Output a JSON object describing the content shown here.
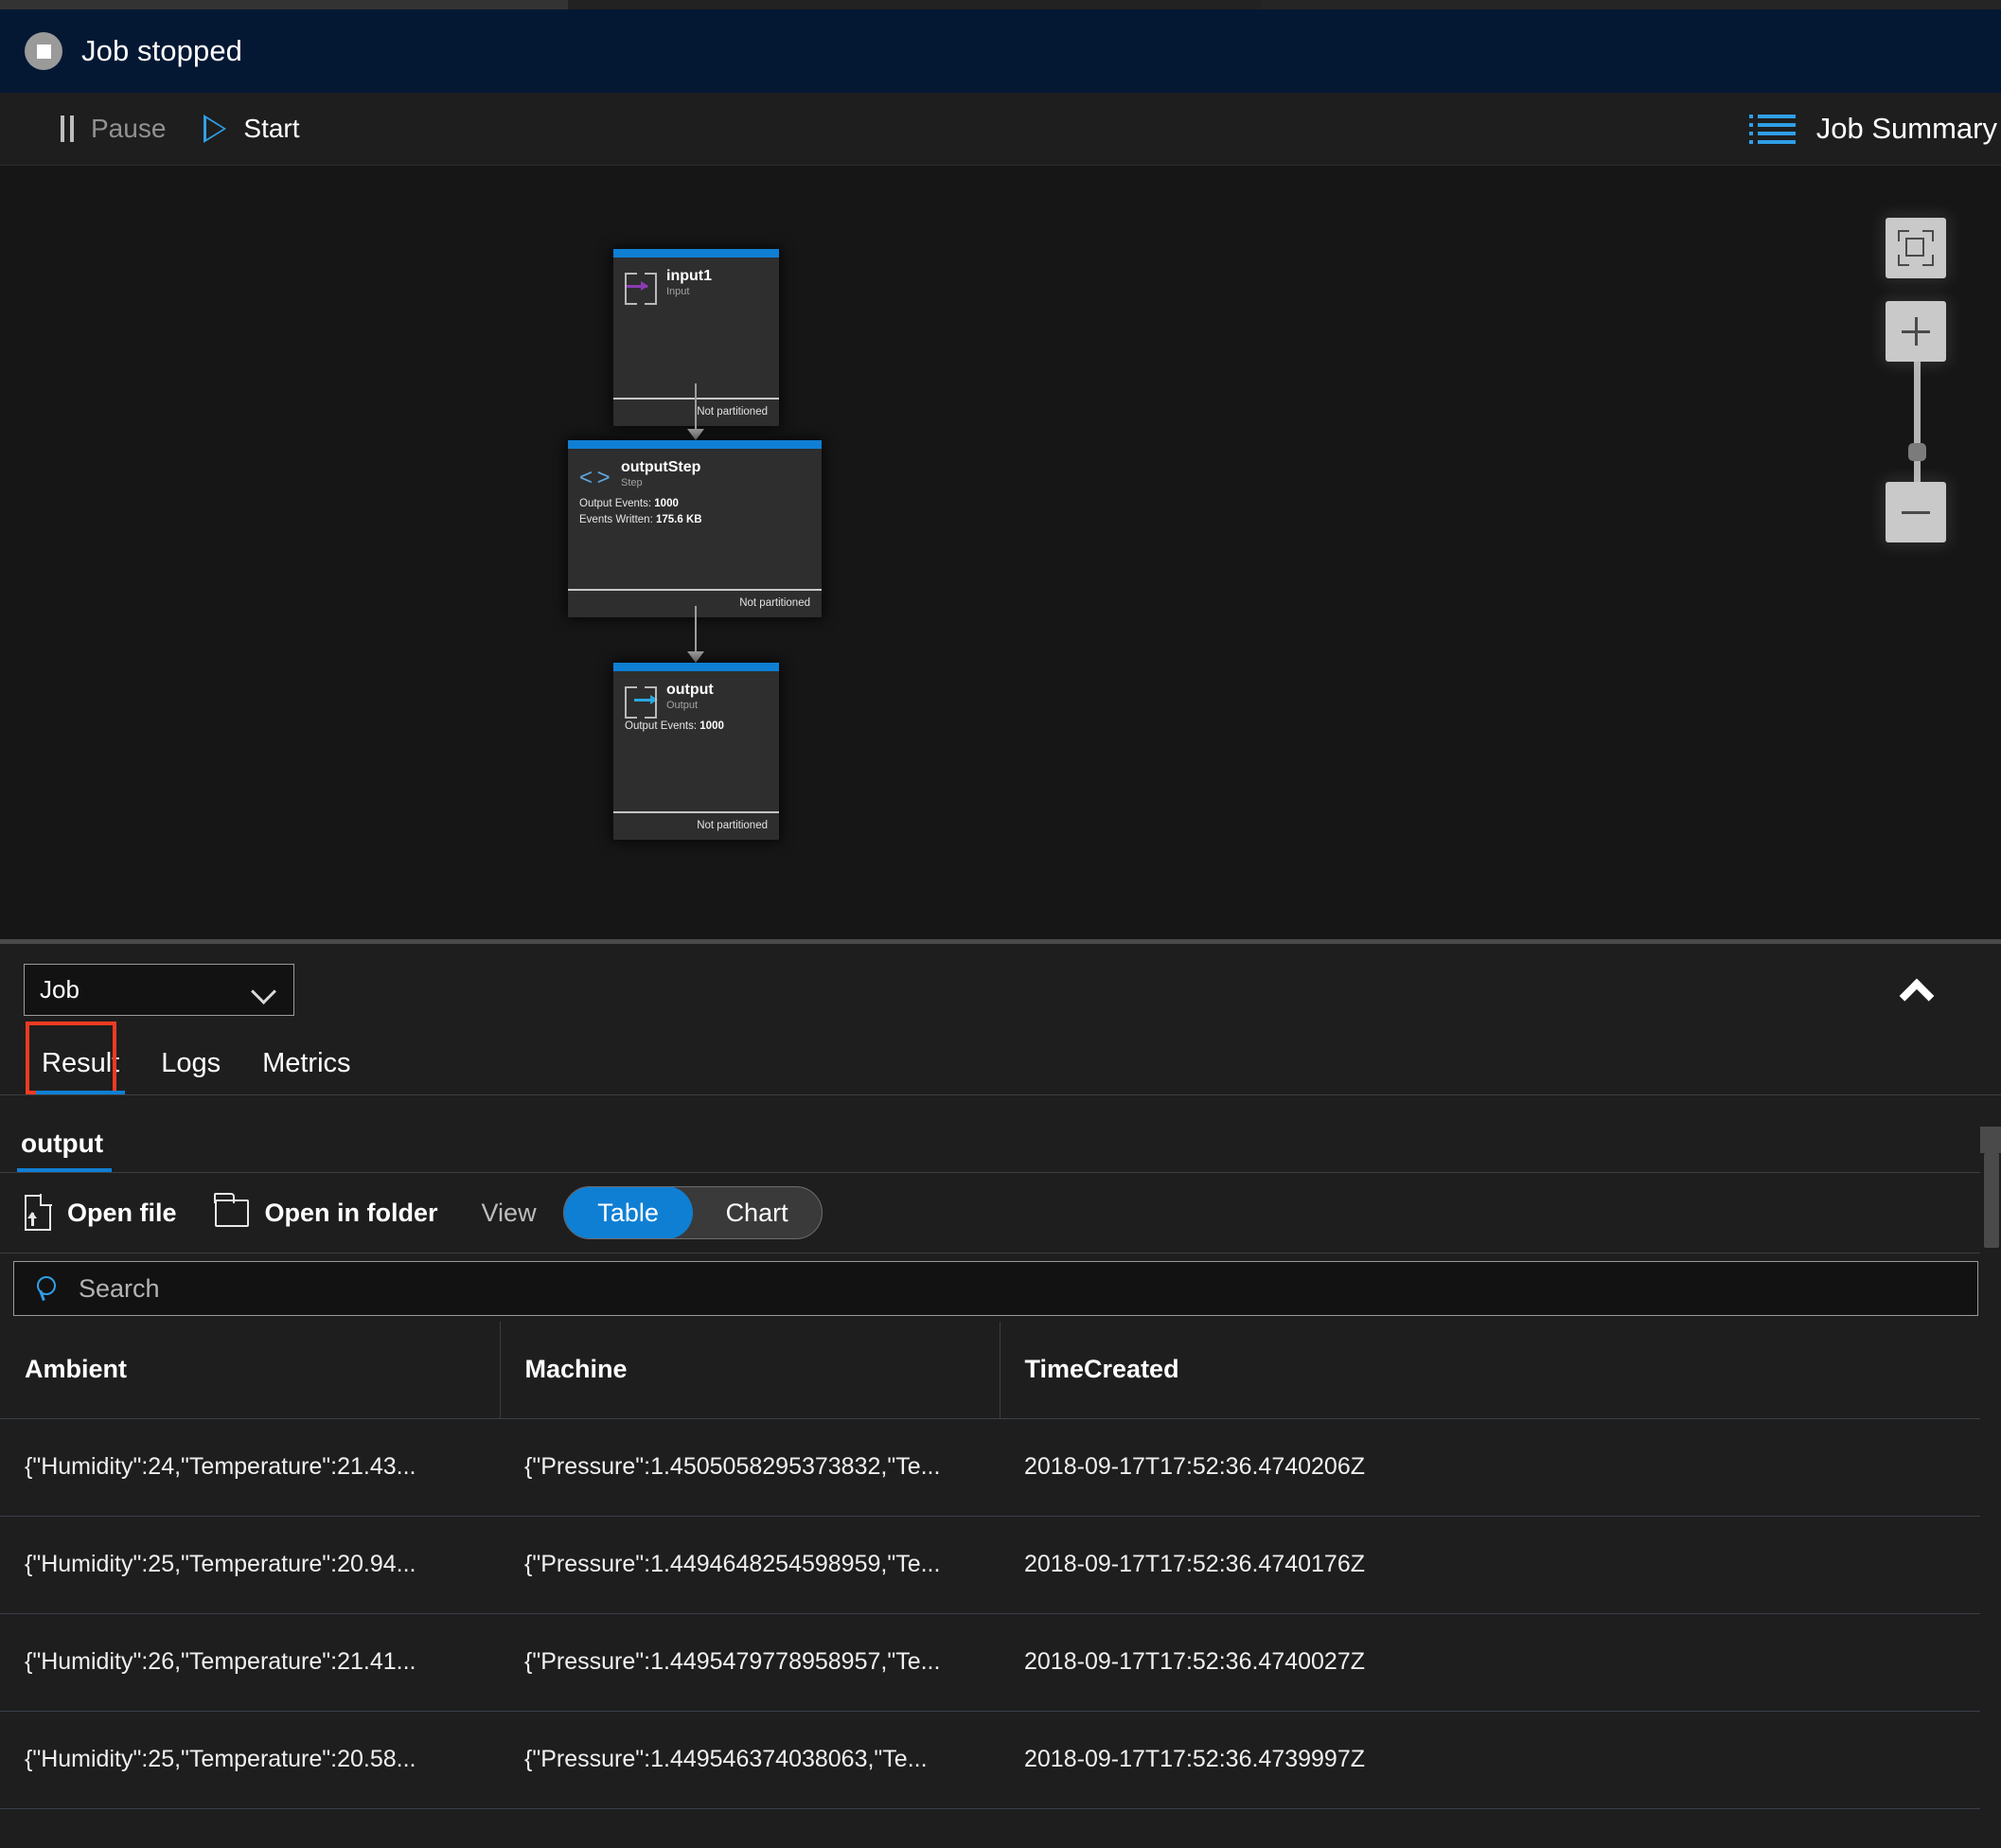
{
  "status": {
    "label": "Job stopped",
    "icon": "stop-circle-icon",
    "banner_color": "#041833"
  },
  "command_bar": {
    "pause": {
      "label": "Pause",
      "icon": "pause-icon",
      "enabled": false
    },
    "start": {
      "label": "Start",
      "icon": "play-icon",
      "enabled": true
    },
    "job_summary": {
      "label": "Job Summary",
      "icon": "list-icon"
    }
  },
  "diagram": {
    "nodes": [
      {
        "title": "input1",
        "subtitle": "Input",
        "icon": "input-arrow-icon",
        "stats": [],
        "partition": "Not partitioned",
        "accent": "#0f7fd4"
      },
      {
        "title": "outputStep",
        "subtitle": "Step",
        "icon": "code-brackets-icon",
        "stats": [
          {
            "key": "Output Events:",
            "value": "1000"
          },
          {
            "key": "Events Written:",
            "value": "175.6 KB"
          }
        ],
        "partition": "Not partitioned",
        "accent": "#0f7fd4"
      },
      {
        "title": "output",
        "subtitle": "Output",
        "icon": "output-arrow-icon",
        "stats": [
          {
            "key": "Output Events:",
            "value": "1000"
          }
        ],
        "partition": "Not partitioned",
        "accent": "#0f7fd4"
      }
    ],
    "zoom_controls": {
      "fit": "fit-to-screen-icon",
      "zoom_in": "plus-icon",
      "zoom_out": "minus-icon",
      "slider_value": 50
    }
  },
  "bottom_panel": {
    "scope_select": {
      "value": "Job",
      "icon": "chevron-down-icon"
    },
    "collapse": {
      "icon": "chevron-up-icon"
    },
    "tabs": [
      {
        "label": "Result",
        "active": true,
        "annotated": true
      },
      {
        "label": "Logs",
        "active": false,
        "annotated": false
      },
      {
        "label": "Metrics",
        "active": false,
        "annotated": false
      }
    ],
    "output_tab": {
      "label": "output",
      "active": true
    },
    "actions": {
      "open_file": {
        "label": "Open file",
        "icon": "file-upload-icon"
      },
      "open_in_folder": {
        "label": "Open in folder",
        "icon": "folder-icon"
      },
      "view_label": "View",
      "view_modes": [
        {
          "label": "Table",
          "selected": true
        },
        {
          "label": "Chart",
          "selected": false
        }
      ]
    },
    "search": {
      "placeholder": "Search",
      "value": "",
      "icon": "search-icon"
    },
    "table": {
      "columns": [
        "Ambient",
        "Machine",
        "TimeCreated"
      ],
      "rows": [
        [
          "{\"Humidity\":24,\"Temperature\":21.43...",
          "{\"Pressure\":1.4505058295373832,\"Te...",
          "2018-09-17T17:52:36.4740206Z"
        ],
        [
          "{\"Humidity\":25,\"Temperature\":20.94...",
          "{\"Pressure\":1.4494648254598959,\"Te...",
          "2018-09-17T17:52:36.4740176Z"
        ],
        [
          "{\"Humidity\":26,\"Temperature\":21.41...",
          "{\"Pressure\":1.4495479778958957,\"Te...",
          "2018-09-17T17:52:36.4740027Z"
        ],
        [
          "{\"Humidity\":25,\"Temperature\":20.58...",
          "{\"Pressure\":1.449546374038063,\"Te...",
          "2018-09-17T17:52:36.4739997Z"
        ]
      ]
    }
  },
  "theme": {
    "accent": "#0f7fd4",
    "annotation": "#ef3b22",
    "background": "#1e1e1e",
    "canvas": "#161616"
  }
}
